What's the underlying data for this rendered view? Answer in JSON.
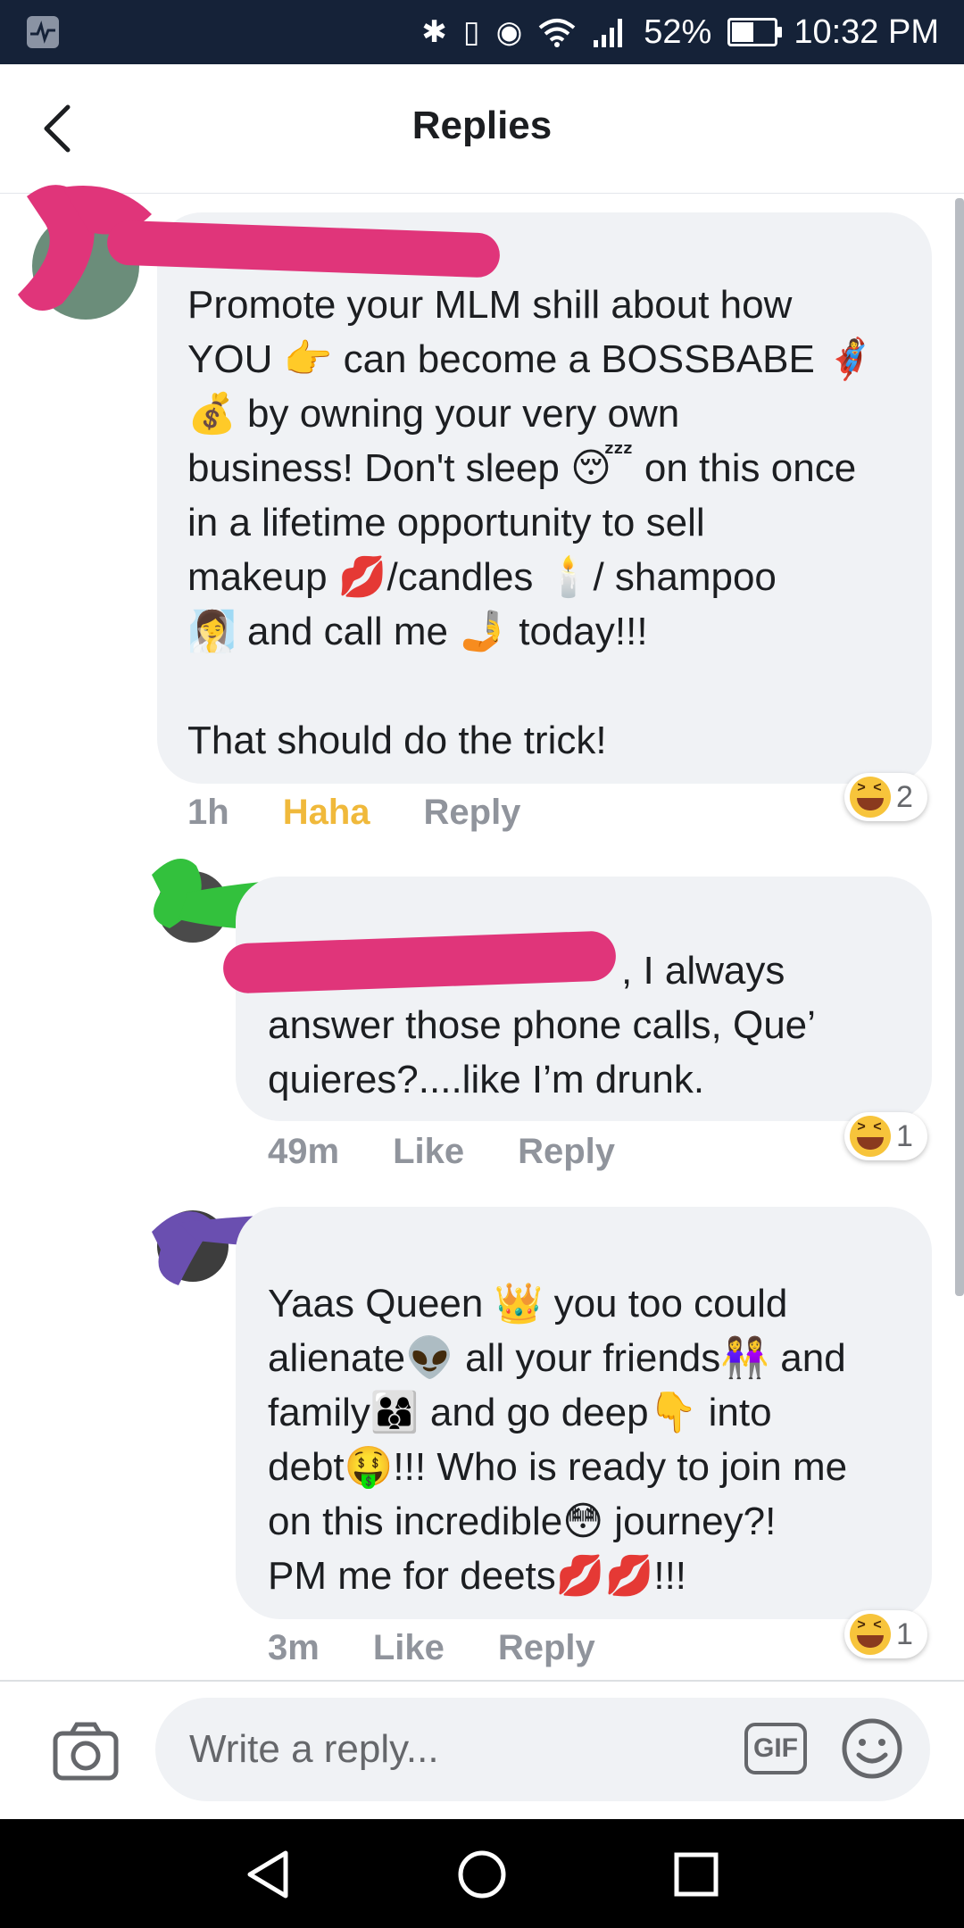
{
  "status_bar": {
    "battery_text": "52%",
    "battery_level": 0.52,
    "time": "10:32 PM",
    "icons": [
      "pulse-icon",
      "bluetooth-icon",
      "vibrate-icon",
      "eye-icon",
      "wifi-icon",
      "signal-icon",
      "battery-icon"
    ]
  },
  "header": {
    "title": "Replies",
    "back_icon": "chevron-left-icon"
  },
  "comments": [
    {
      "redaction_color": "#e0357a",
      "text": "Promote your MLM shill about how\nYOU 👉 can become a BOSSBABE 🦸‍♀️\n💰 by owning your very own\nbusiness! Don't sleep 😴 on this once\nin a lifetime opportunity to sell\nmakeup 💋/candles 🕯️/ shampoo\n🧖‍♀️ and call me 🤳 today!!!\n\nThat should do the trick!",
      "time": "1h",
      "reaction_label": "Haha",
      "reply_label": "Reply",
      "reaction_count": "2"
    },
    {
      "redaction_color": "#33c13d",
      "redaction_color_2": "#e0357a",
      "text_visible_first_line": ", I always",
      "text": "answer those phone calls, Que’\nquieres?....like I’m drunk.",
      "time": "49m",
      "like_label": "Like",
      "reply_label": "Reply",
      "reaction_count": "1"
    },
    {
      "redaction_color": "#6a4fb0",
      "text": "Yaas Queen 👑 you too could\nalienate👽 all your friends👭 and\nfamily👨‍👩‍👦 and go deep👇 into\ndebt🤑!!! Who is ready to join me\non this incredible😳 journey?!\nPM me for deets💋💋!!!",
      "time": "3m",
      "like_label": "Like",
      "reply_label": "Reply",
      "reaction_count": "1"
    }
  ],
  "composer": {
    "placeholder": "Write a reply...",
    "gif_label": "GIF",
    "camera_icon": "camera-icon",
    "emoji_icon": "smiley-icon"
  },
  "nav": {
    "icons": [
      "back-triangle-icon",
      "home-circle-icon",
      "recents-square-icon"
    ]
  }
}
